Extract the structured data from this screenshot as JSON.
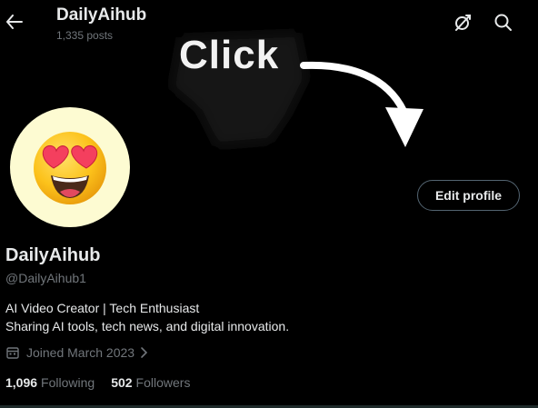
{
  "header": {
    "title": "DailyAihub",
    "posts_count": "1,335 posts",
    "back_icon": "arrow-left-icon",
    "grok_icon": "grok-icon",
    "search_icon": "search-icon"
  },
  "banner": {
    "text": "Click"
  },
  "profile": {
    "avatar_icon": "heart-eyes-emoji",
    "edit_label": "Edit profile",
    "name": "DailyAihub",
    "handle": "@DailyAihub1",
    "bio_line1": "AI Video Creator | Tech Enthusiast",
    "bio_line2": "Sharing AI tools, tech news, and digital innovation.",
    "joined": "Joined March 2023",
    "following_count": "1,096",
    "following_label": "Following",
    "followers_count": "502",
    "followers_label": "Followers"
  },
  "colors": {
    "background": "#000000",
    "primary_text": "#e7e9ea",
    "secondary_text": "#71767b",
    "avatar_bg": "#fdfbd2"
  }
}
